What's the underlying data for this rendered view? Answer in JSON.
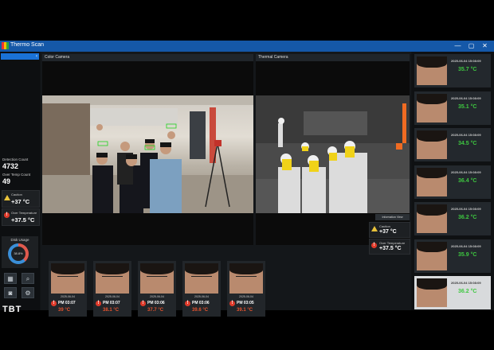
{
  "window": {
    "title": "Thermo Scan",
    "min": "—",
    "max": "▢",
    "close": "✕"
  },
  "left": {
    "detection_label": "Detection Count",
    "detection_value": "4732",
    "overtemp_label": "Over Temp Count",
    "overtemp_value": "49",
    "caution_label": "Caution",
    "caution_value": "+37 °C",
    "over_label": "Over Temperature",
    "over_value": "+37.5 °C",
    "disk_label": "Disk Usage",
    "disk_value": "38.8%",
    "disk_fraction": 0.38,
    "logo": "TBT"
  },
  "cameras": {
    "color_title": "Color Camera",
    "thermal_title": "Thermal Camera",
    "info_label": "Information View",
    "caution_label": "Caution",
    "caution_value": "+37 °C",
    "over_label": "Over Temperature",
    "over_value": "+37.5 °C"
  },
  "thumbs": [
    {
      "date": "2025-06-04",
      "time": "PM 03:07",
      "temp": "39 °C"
    },
    {
      "date": "2025-06-04",
      "time": "PM 03:07",
      "temp": "38.1 °C"
    },
    {
      "date": "2025-06-04",
      "time": "PM 03:06",
      "temp": "37.7 °C"
    },
    {
      "date": "2025-06-04",
      "time": "PM 03:06",
      "temp": "39.6 °C"
    },
    {
      "date": "2025-06-04",
      "time": "PM 03:05",
      "temp": "39.1 °C"
    }
  ],
  "history": [
    {
      "date": "2025-06-04 15:08:09",
      "temp": "35.7 °C"
    },
    {
      "date": "2025-06-04 15:08:09",
      "temp": "35.1 °C"
    },
    {
      "date": "2025-06-04 15:08:09",
      "temp": "34.5 °C"
    },
    {
      "date": "2025-06-04 15:08:09",
      "temp": "36.4 °C"
    },
    {
      "date": "2025-06-04 15:08:09",
      "temp": "36.2 °C"
    },
    {
      "date": "2025-06-04 15:08:09",
      "temp": "35.9 °C"
    },
    {
      "date": "2025-06-04 15:08:09",
      "temp": "36.2 °C"
    }
  ],
  "colors": {
    "accent": "#1a72d6",
    "ok": "#3ec840",
    "alert": "#e8542e",
    "caution": "#e8c23a"
  }
}
